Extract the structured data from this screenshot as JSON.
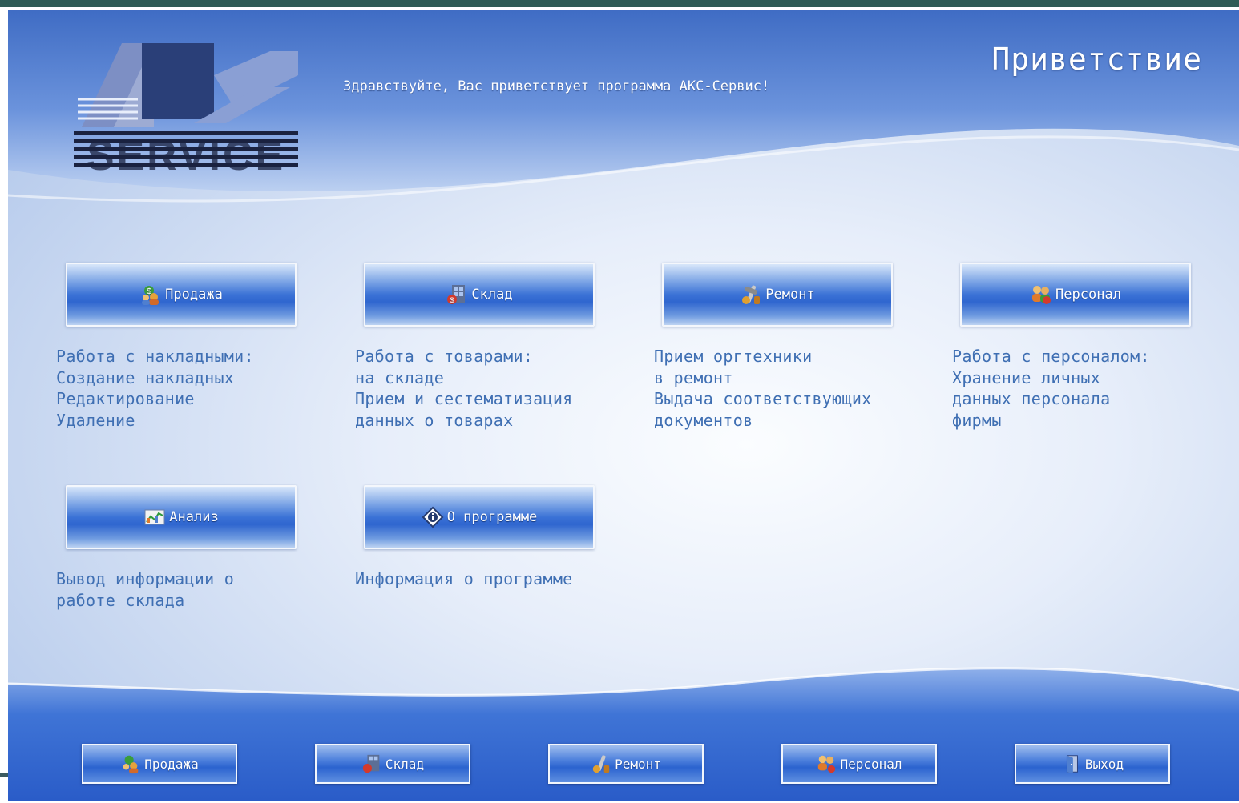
{
  "window": {
    "title": "Приветствие",
    "greeting": "Здравствуйте, Вас приветствует программа АКС-Сервис!",
    "logo_text": "SERVICE"
  },
  "tiles": [
    {
      "label": "Продажа",
      "icon": "money-people-icon",
      "description": "Работа с накладными:\nСоздание накладных\nРедактирование\nУдаление"
    },
    {
      "label": "Склад",
      "icon": "warehouse-icon",
      "description": "Работа с товарами:\nна складе\nПрием и сестематизация\nданных о товарах"
    },
    {
      "label": "Ремонт",
      "icon": "repair-tools-icon",
      "description": "Прием оргтехники\nв ремонт\nВыдача соответствующих\nдокументов"
    },
    {
      "label": "Персонал",
      "icon": "staff-icon",
      "description": "Работа с персоналом:\nХранение личных\nданных персонала\nфирмы"
    },
    {
      "label": "Анализ",
      "icon": "chart-analysis-icon",
      "description": "Вывод информации о\nработе склада"
    },
    {
      "label": "О программе",
      "icon": "info-icon",
      "description": "Информация о программе"
    }
  ],
  "footer": [
    {
      "label": "Продажа",
      "icon": "money-people-icon"
    },
    {
      "label": "Склад",
      "icon": "warehouse-icon"
    },
    {
      "label": "Ремонт",
      "icon": "repair-tools-icon"
    },
    {
      "label": "Персонал",
      "icon": "staff-icon"
    },
    {
      "label": "Выход",
      "icon": "exit-door-icon"
    }
  ],
  "colors": {
    "header_wave": "#5b87d9",
    "footer_wave": "#3e72d4",
    "button_blue": "#2f66cf",
    "description_text": "#3f6fb3",
    "frame_dark": "#2f5b55"
  }
}
